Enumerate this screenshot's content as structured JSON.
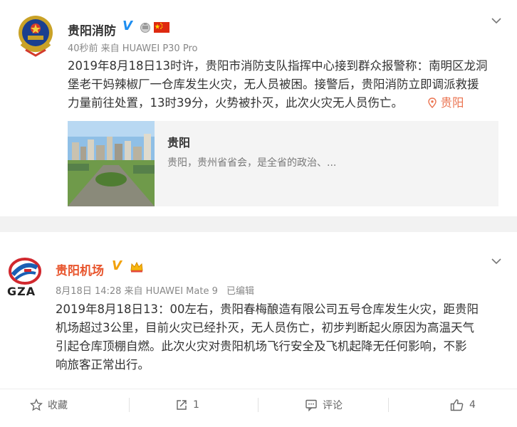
{
  "post1": {
    "author": "贵阳消防",
    "meta": "40秒前 来自 HUAWEI P30 Pro",
    "lines": [
      "2019年8月18日13时许，贵阳市消防支队指挥中心接到群众报警称：南明区龙洞",
      "堡老干妈辣椒厂一仓库发生火灾，无人员被困。接警后，贵阳消防立即调派救援",
      "力量前往处置，13时39分，火势被扑灭，此次火灾无人员伤亡。"
    ],
    "location": "贵阳",
    "link_card": {
      "title": "贵阳",
      "description": "贵阳，贵州省省会，是全省的政治、..."
    }
  },
  "post2": {
    "author": "贵阳机场",
    "avatar_text": "GZA",
    "meta": "8月18日 14:28 来自 HUAWEI Mate 9",
    "edited": "已编辑",
    "lines": [
      "2019年8月18日13：00左右，贵阳春梅酿造有限公司五号仓库发生火灾，距贵阳",
      "机场超过3公里，目前火灾已经扑灭，无人员伤亡，初步判断起火原因为高温天气",
      "引起仓库顶棚自燃。此次火灾对贵阳机场飞行安全及飞机起降无任何影响，不影",
      "响旅客正常出行。"
    ],
    "actions": {
      "collect": "收藏",
      "repost": "1",
      "comment": "评论",
      "like": "4"
    }
  },
  "colors": {
    "verified_blue": "#1e8ef0",
    "location_orange": "#eb7350",
    "flag_red": "#de2910"
  },
  "icons": [
    "police-emblem-icon",
    "verified-v-icon",
    "member-crown-icon",
    "china-flag-icon",
    "chevron-down-icon",
    "location-pin-icon",
    "star-icon",
    "share-icon",
    "comment-icon",
    "thumbs-up-icon"
  ]
}
